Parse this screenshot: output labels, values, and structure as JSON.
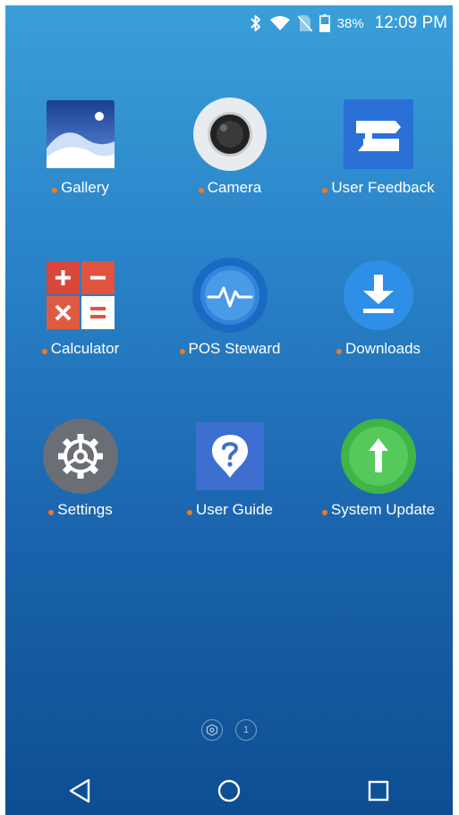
{
  "status_bar": {
    "icons": [
      "bluetooth-icon",
      "wifi-icon",
      "no-sim-icon",
      "battery-icon"
    ],
    "battery_percent": "38%",
    "time": "12:09 PM"
  },
  "apps": [
    {
      "label": "Gallery",
      "icon": "gallery-icon"
    },
    {
      "label": "Camera",
      "icon": "camera-icon"
    },
    {
      "label": "User Feedback",
      "icon": "feedback-icon"
    },
    {
      "label": "Calculator",
      "icon": "calculator-icon"
    },
    {
      "label": "POS Steward",
      "icon": "pulse-icon"
    },
    {
      "label": "Downloads",
      "icon": "download-icon"
    },
    {
      "label": "Settings",
      "icon": "gear-icon"
    },
    {
      "label": "User Guide",
      "icon": "question-icon"
    },
    {
      "label": "System Update",
      "icon": "arrow-up-icon"
    }
  ],
  "page_indicator": {
    "home_icon": "hexagon-home-icon",
    "page_number": "1"
  },
  "nav_bar": {
    "icons": [
      "back-triangle-icon",
      "home-circle-icon",
      "recents-square-icon"
    ]
  },
  "colors": {
    "background_top": "#3a9fd9",
    "background_bottom": "#0d4e92",
    "new_app_dot": "#f07a22"
  }
}
